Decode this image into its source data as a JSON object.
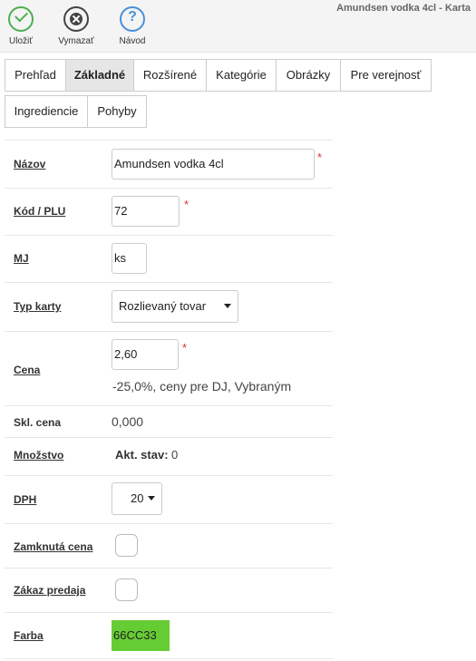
{
  "window_title": "Amundsen vodka 4cl - Karta",
  "toolbar": {
    "save_label": "Uložiť",
    "save_icon": "check-circle-icon",
    "delete_label": "Vymazať",
    "delete_icon": "close-circle-icon",
    "help_label": "Návod",
    "help_icon": "question-circle-icon",
    "help_glyph": "?"
  },
  "tabs": [
    {
      "label": "Prehľad",
      "active": false
    },
    {
      "label": "Základné",
      "active": true
    },
    {
      "label": "Rozšírené",
      "active": false
    },
    {
      "label": "Kategórie",
      "active": false
    },
    {
      "label": "Obrázky",
      "active": false
    },
    {
      "label": "Pre verejnosť",
      "active": false
    },
    {
      "label": "Ingrediencie",
      "active": false
    },
    {
      "label": "Pohyby",
      "active": false
    }
  ],
  "form": {
    "name": {
      "label": "Názov",
      "value": "Amundsen vodka 4cl",
      "required_mark": "*"
    },
    "code": {
      "label": "Kód / PLU",
      "value": "72",
      "required_mark": "*"
    },
    "unit": {
      "label": "MJ",
      "value": "ks"
    },
    "card_type": {
      "label": "Typ karty",
      "value": "Rozlievaný tovar"
    },
    "price": {
      "label": "Cena",
      "value": "2,60",
      "required_mark": "*",
      "note": "-25,0%, ceny pre DJ, Vybraným"
    },
    "stock_price": {
      "label": "Skl. cena",
      "value": "0,000"
    },
    "quantity": {
      "label": "Množstvo",
      "stock_label": "Akt. stav:",
      "stock_value": "0"
    },
    "vat": {
      "label": "DPH",
      "value": "20"
    },
    "locked_price": {
      "label": "Zamknutá cena",
      "checked": false
    },
    "sale_ban": {
      "label": "Zákaz predaja",
      "checked": false
    },
    "color": {
      "label": "Farba",
      "value": "66CC33",
      "swatch": "#66CC33"
    }
  },
  "colors": {
    "save": "#4caf50",
    "help": "#4a90d9",
    "required": "#e03030",
    "active_tab": "#e6e6e6"
  }
}
